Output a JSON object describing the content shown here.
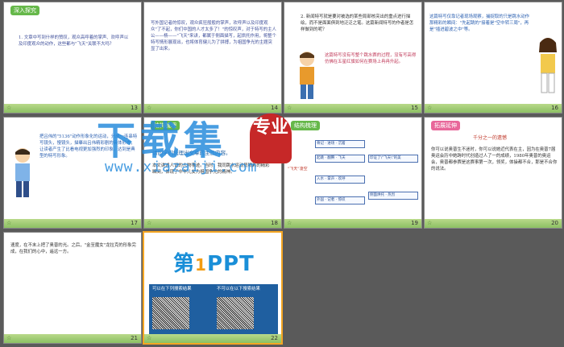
{
  "slides": [
    {
      "num": "13",
      "tag": "深入探究",
      "text": "1. 文章中写到什样的赞叹，观众高呼着的掌声、欢呼声以及印度观众的动作，这些都与\"飞天\"关联不大吗？"
    },
    {
      "num": "14",
      "text": "写外国记者的惊叹，观众疯狂般般的掌声，欢呼声以及印度观众\"了不起，你们中国的人才太多了！\"的惊叹声，对于特写的主人公——杨——\"飞天\"来讲，都属于侧面描写，起烘托作用，将整个特写情形展现出，也将体育健儿为了拼搏，为祖国争光的主题突显了出来。"
    },
    {
      "num": "15",
      "text": "2. 新闻特写就是要对被选的某些局部核突出的重点进行描绘，而不是面面俱到地泛泛之笔。这篇新闻特写的作者是怎样做到的呢？"
    },
    {
      "num": "16",
      "text": "这篇特写仅靠记者现场观察，捕捉取的只是跳水动作那精彩的瞬间：\"先起跳的\"接着是\"空中转三周\"，再是\"插进碧波之中\"等。"
    },
    {
      "num": "17",
      "text": "把吕伟的\"5136\"动作形象化的运动，分成一连串特写镜头，慢镜头，描摹出吕伟精彩剧的具体形态，让读者产生了比看电视更加强烈的印象，达到是典型的特写形象。"
    },
    {
      "num": "18",
      "tag": "结构梳理",
      "text": "请同学们梳理出文章的主旨内容。"
    },
    {
      "num": "19",
      "tag": "结构梳理",
      "text": "\"飞天\"凌空"
    },
    {
      "num": "20",
      "tag": "拓展延伸",
      "title": "千分之一的遗憾",
      "text": "你可以说奥普生不迷时，你可以说她近代表在主，因为在奥普7届奥运会历中她跨时代创造过人了一的成绩，1980年奥普的奥运会，奥普都参赛是这赛事第一次，领奖，体操都不合，那是不合你的说法。"
    },
    {
      "num": "21",
      "text": "速度，在不末上把了奥普的光。之后，\"金至魔女\"龙拉克的形象完成，在我们的心中，遥远一方。"
    },
    {
      "num": "22",
      "logo_main": "第",
      "logo_num": "1",
      "logo_tail": "PPT",
      "left_label": "可以在下列搜索结果",
      "right_label": "不可以在以下搜索结果"
    }
  ],
  "watermark": {
    "big": "下载集",
    "seal": "专业",
    "url": "www.xiazaiji.com"
  }
}
